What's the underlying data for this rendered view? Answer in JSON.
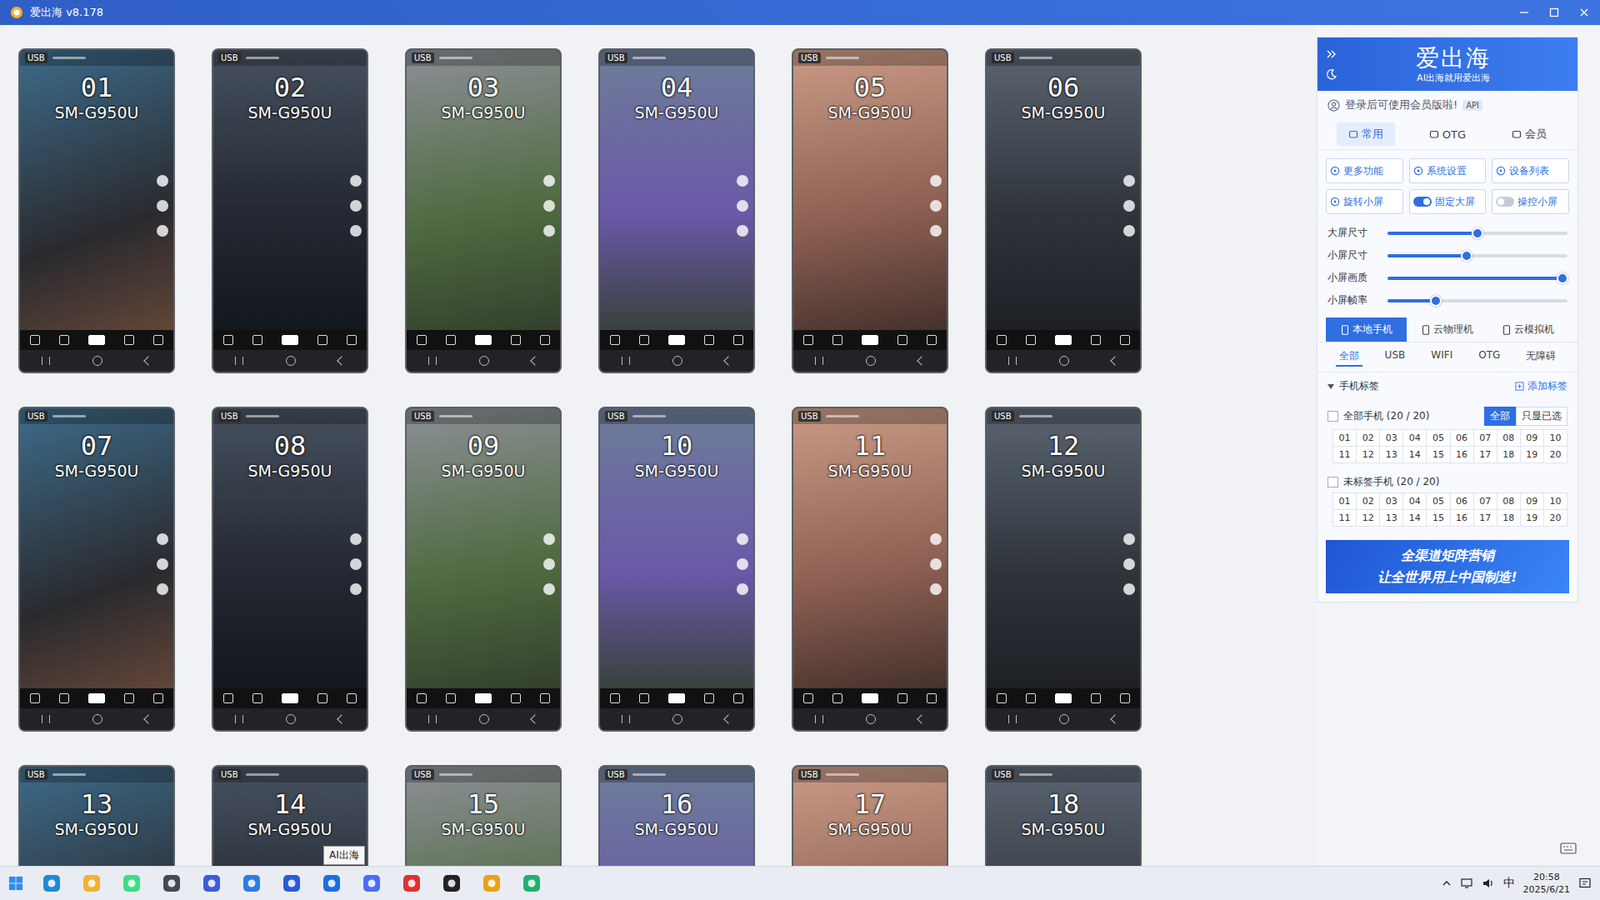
{
  "window": {
    "title": "爱出海 v8.178"
  },
  "devices": [
    {
      "number": "01",
      "model": "SM-G950U",
      "badge": "USB"
    },
    {
      "number": "02",
      "model": "SM-G950U",
      "badge": "USB"
    },
    {
      "number": "03",
      "model": "SM-G950U",
      "badge": "USB"
    },
    {
      "number": "04",
      "model": "SM-G950U",
      "badge": "USB"
    },
    {
      "number": "05",
      "model": "SM-G950U",
      "badge": "USB"
    },
    {
      "number": "06",
      "model": "SM-G950U",
      "badge": "USB"
    },
    {
      "number": "07",
      "model": "SM-G950U",
      "badge": "USB"
    },
    {
      "number": "08",
      "model": "SM-G950U",
      "badge": "USB"
    },
    {
      "number": "09",
      "model": "SM-G950U",
      "badge": "USB"
    },
    {
      "number": "10",
      "model": "SM-G950U",
      "badge": "USB"
    },
    {
      "number": "11",
      "model": "SM-G950U",
      "badge": "USB"
    },
    {
      "number": "12",
      "model": "SM-G950U",
      "badge": "USB"
    },
    {
      "number": "13",
      "model": "SM-G950U",
      "badge": "USB"
    },
    {
      "number": "14",
      "model": "SM-G950U",
      "badge": "USB"
    },
    {
      "number": "15",
      "model": "SM-G950U",
      "badge": "USB"
    },
    {
      "number": "16",
      "model": "SM-G950U",
      "badge": "USB"
    },
    {
      "number": "17",
      "model": "SM-G950U",
      "badge": "USB"
    },
    {
      "number": "18",
      "model": "SM-G950U",
      "badge": "USB"
    }
  ],
  "panel": {
    "brand": "爱出海",
    "slogan": "AI出海就用爱出海",
    "login_notice": "登录后可使用会员版啦!",
    "api_badge": "API",
    "tabs": [
      {
        "label": "常用",
        "selected": true
      },
      {
        "label": "OTG",
        "selected": false
      },
      {
        "label": "会员",
        "selected": false
      }
    ],
    "actions": [
      {
        "label": "更多功能",
        "kind": "button"
      },
      {
        "label": "系统设置",
        "kind": "button"
      },
      {
        "label": "设备列表",
        "kind": "button"
      },
      {
        "label": "旋转小屏",
        "kind": "button"
      },
      {
        "label": "固定大屏",
        "kind": "toggle",
        "on": true
      },
      {
        "label": "操控小屏",
        "kind": "toggle",
        "on": false
      }
    ],
    "sliders": [
      {
        "label": "大屏尺寸",
        "level": 0.5
      },
      {
        "label": "小屏尺寸",
        "level": 0.44
      },
      {
        "label": "小屏画质",
        "level": 0.97
      },
      {
        "label": "小屏帧率",
        "level": 0.27
      }
    ],
    "source_tabs": [
      {
        "label": "本地手机",
        "selected": true
      },
      {
        "label": "云物理机",
        "selected": false
      },
      {
        "label": "云模拟机",
        "selected": false
      }
    ],
    "filter_tabs": [
      {
        "label": "全部",
        "selected": true
      },
      {
        "label": "USB",
        "selected": false
      },
      {
        "label": "WIFI",
        "selected": false
      },
      {
        "label": "OTG",
        "selected": false
      },
      {
        "label": "无障碍",
        "selected": false
      }
    ],
    "tag_section": {
      "title": "手机标签",
      "expanded": true,
      "add_label": "添加标签"
    },
    "groups": [
      {
        "label": "全部手机 (20 / 20)",
        "checked": false,
        "filters": [
          {
            "label": "全部",
            "selected": true
          },
          {
            "label": "只显已选",
            "selected": false
          }
        ],
        "numbers": [
          "01",
          "02",
          "03",
          "04",
          "05",
          "06",
          "07",
          "08",
          "09",
          "10",
          "11",
          "12",
          "13",
          "14",
          "15",
          "16",
          "17",
          "18",
          "19",
          "20"
        ]
      },
      {
        "label": "未标签手机 (20 / 20)",
        "checked": false,
        "filters": [],
        "numbers": [
          "01",
          "02",
          "03",
          "04",
          "05",
          "06",
          "07",
          "08",
          "09",
          "10",
          "11",
          "12",
          "13",
          "14",
          "15",
          "16",
          "17",
          "18",
          "19",
          "20"
        ]
      }
    ],
    "banner": [
      "全渠道矩阵营销",
      "让全世界用上中国制造!"
    ]
  },
  "taskbar": {
    "tooltip": "AI出海",
    "ime": "中",
    "time": "20:58",
    "date": "2025/6/21"
  }
}
